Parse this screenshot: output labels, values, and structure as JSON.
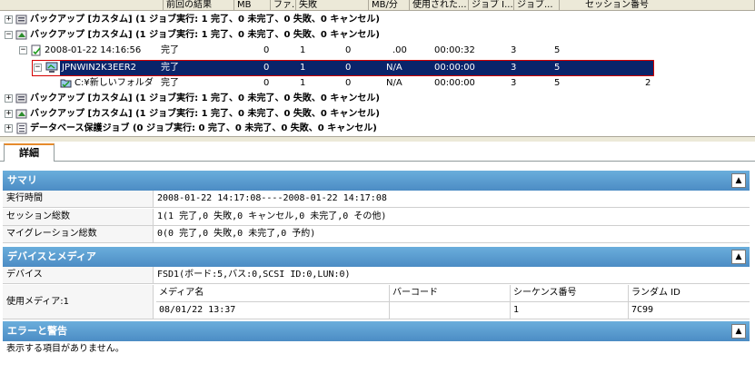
{
  "columns": [
    "前回の結果",
    "MB",
    "ファ...",
    "失敗",
    "MB/分",
    "使用された...",
    "ジョブ I...",
    "ジョブ...",
    "セッション番号"
  ],
  "tree": {
    "rows": [
      {
        "title": "バックアップ [カスタム] (1 ジョブ実行: 1 完了、0 未完了、0 失敗、0 キャンセル)"
      },
      {
        "title": "バックアップ [カスタム] (1 ジョブ実行: 1 完了、0 未完了、0 失敗、0 キャンセル)"
      },
      {
        "title": "2008-01-22 14:16:56",
        "result": "完了",
        "mb": "0",
        "files": "1",
        "failed": "0",
        "mbmin": ".00",
        "used": "00:00:32",
        "jobid": "3",
        "jobno": "5",
        "session": ""
      },
      {
        "title": "JPNWIN2K3EER2",
        "result": "完了",
        "mb": "0",
        "files": "1",
        "failed": "0",
        "mbmin": "N/A",
        "used": "00:00:00",
        "jobid": "3",
        "jobno": "5",
        "session": ""
      },
      {
        "title": "C:¥新しいフォルダ",
        "result": "完了",
        "mb": "0",
        "files": "1",
        "failed": "0",
        "mbmin": "N/A",
        "used": "00:00:00",
        "jobid": "3",
        "jobno": "5",
        "session": "2"
      },
      {
        "title": "バックアップ [カスタム] (1 ジョブ実行: 1 完了、0 未完了、0 失敗、0 キャンセル)"
      },
      {
        "title": "バックアップ [カスタム] (1 ジョブ実行: 1 完了、0 未完了、0 失敗、0 キャンセル)"
      },
      {
        "title": "データベース保護ジョブ (0 ジョブ実行: 0 完了、0 未完了、0 失敗、0 キャンセル)"
      }
    ]
  },
  "tab": {
    "label": "詳細"
  },
  "summary": {
    "header": "サマリ",
    "rows": [
      {
        "label": "実行時間",
        "value": "2008-01-22 14:17:08----2008-01-22 14:17:08"
      },
      {
        "label": "セッション総数",
        "value": "1(1 完了,0 失敗,0 キャンセル,0 未完了,0 その他)"
      },
      {
        "label": "マイグレーション総数",
        "value": "0(0 完了,0 失敗,0 未完了,0 予約)"
      }
    ]
  },
  "devices": {
    "header": "デバイスとメディア",
    "device_label": "デバイス",
    "device_value": "FSD1(ボード:5,バス:0,SCSI ID:0,LUN:0)",
    "media_label": "使用メディア:1",
    "media_headers": [
      "メディア名",
      "バーコード",
      "シーケンス番号",
      "ランダム ID"
    ],
    "media_values": [
      "08/01/22 13:37",
      "",
      "1",
      "7C99"
    ]
  },
  "errors": {
    "header": "エラーと警告",
    "message": "表示する項目がありません。"
  },
  "colors": {
    "section": "#5c9fd4",
    "selection": "#0a246a",
    "highlight_border": "#d40000"
  }
}
